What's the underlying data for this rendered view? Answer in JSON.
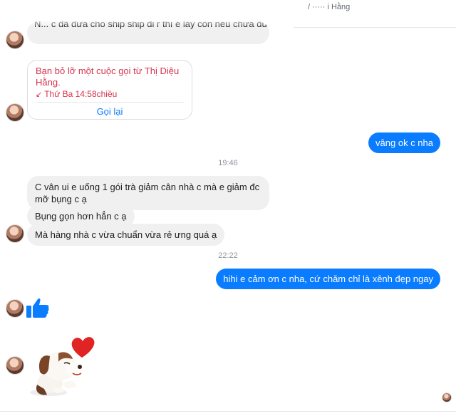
{
  "header": {
    "cut_text": "/ ····· i Hằng"
  },
  "messages": {
    "cut_top": "N... c đã đưa cho ship ship đi r thì e lấy còn nếu chưa đưa",
    "missed_call": {
      "text": "Bạn bỏ lỡ một cuộc gọi từ Thị Diệu Hằng.",
      "time": "Thứ Ba 14:58chiều",
      "action": "Gọi lại"
    },
    "out_1": "vâng ok c nha",
    "time_1": "19:46",
    "in_1": "C vân ui e uống 1 gói trà giảm cân nhà c mà e giảm đc mỡ bụng c ạ",
    "in_2": "Bụng gọn hơn hẳn c ạ",
    "in_3": "Mà hàng nhà c vừa chuẩn vừa rẻ ưng quá ạ",
    "time_2": "22:22",
    "out_2": "hihi e cảm ơn c nha, cứ chăm chỉ là xênh đẹp ngay"
  },
  "colors": {
    "accent": "#0a7cff",
    "missed": "#d6334e",
    "bubble_in": "#f1f0f0"
  },
  "icons": {
    "like": "thumbs-up-icon",
    "sticker": "puppy-heart-sticker"
  }
}
